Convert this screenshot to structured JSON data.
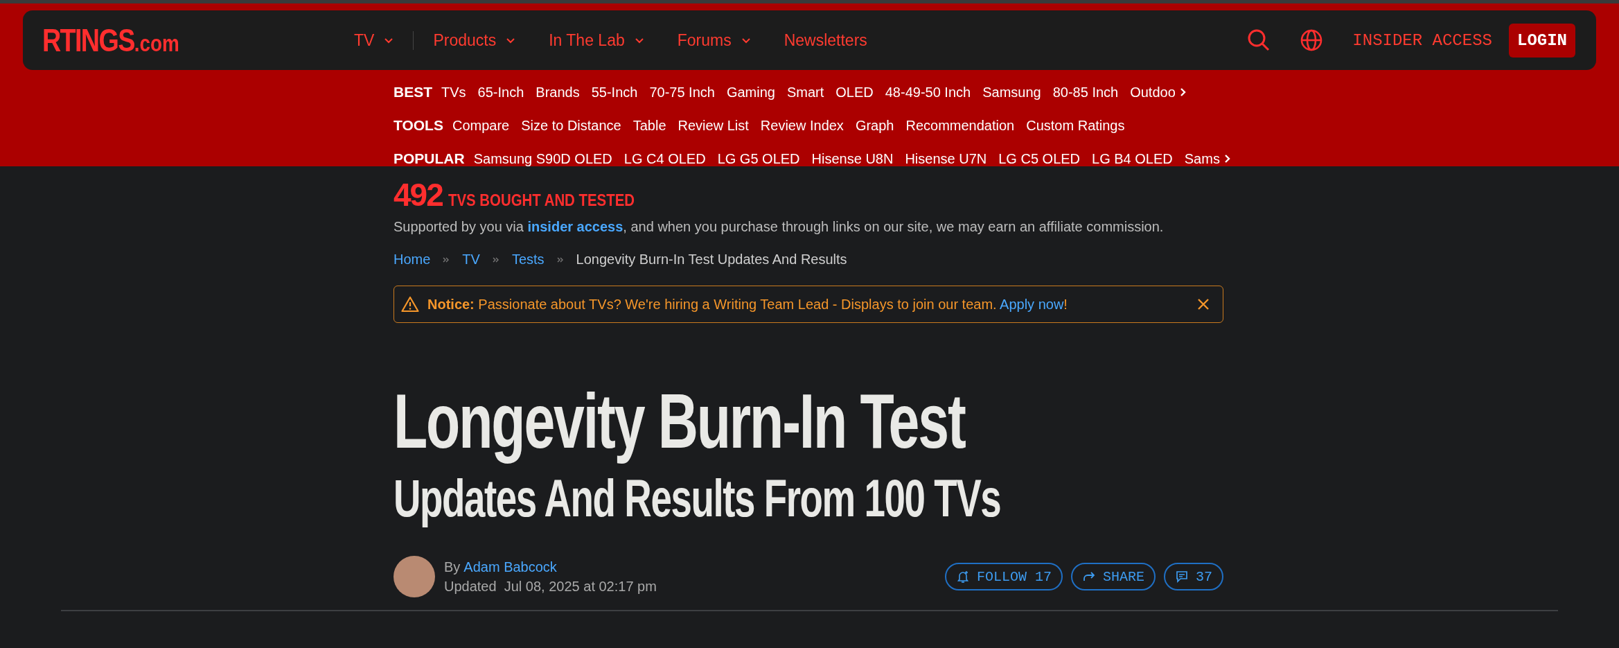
{
  "header": {
    "logo": {
      "main": "RTINGS",
      "suffix": ".com"
    },
    "nav": [
      {
        "label": "TV",
        "has_menu": true,
        "divider_after": true
      },
      {
        "label": "Products",
        "has_menu": true,
        "divider_after": false
      },
      {
        "label": "In The Lab",
        "has_menu": true,
        "divider_after": false
      },
      {
        "label": "Forums",
        "has_menu": true,
        "divider_after": false
      },
      {
        "label": "Newsletters",
        "has_menu": false,
        "divider_after": false
      }
    ],
    "insider_access": "INSIDER ACCESS",
    "login": "LOGIN"
  },
  "subnav": [
    {
      "label": "BEST",
      "items": [
        "TVs",
        "65-Inch",
        "Brands",
        "55-Inch",
        "70-75 Inch",
        "Gaming",
        "Smart",
        "OLED",
        "48-49-50 Inch",
        "Samsung",
        "80-85 Inch",
        "Outdoo"
      ],
      "more": true
    },
    {
      "label": "TOOLS",
      "items": [
        "Compare",
        "Size to Distance",
        "Table",
        "Review List",
        "Review Index",
        "Graph",
        "Recommendation",
        "Custom Ratings"
      ],
      "more": false
    },
    {
      "label": "POPULAR",
      "items": [
        "Samsung S90D OLED",
        "LG C4 OLED",
        "LG G5 OLED",
        "Hisense U8N",
        "Hisense U7N",
        "LG C5 OLED",
        "LG B4 OLED",
        "Sams"
      ],
      "more": true
    }
  ],
  "tested": {
    "count": "492",
    "label": "TVS BOUGHT AND TESTED"
  },
  "support": {
    "before": "Supported by you via ",
    "link": "insider access",
    "after": ", and when you purchase through links on our site, we may earn an affiliate commission."
  },
  "breadcrumbs": [
    {
      "label": "Home",
      "link": true
    },
    {
      "label": "TV",
      "link": true
    },
    {
      "label": "Tests",
      "link": true
    },
    {
      "label": "Longevity Burn-In Test Updates And Results",
      "link": false
    }
  ],
  "notice": {
    "label": "Notice:",
    "text": " Passionate about TVs? We're hiring a Writing Team Lead - Displays to join our team. ",
    "link": "Apply now",
    "end": "!"
  },
  "title": {
    "line1": "Longevity Burn-In Test",
    "line2": "Updates And Results From 100 TVs"
  },
  "byline": {
    "by": "By",
    "author": "Adam Babcock",
    "updated": "Updated  Jul 08, 2025 at 02:17 pm"
  },
  "actions": [
    {
      "kind": "follow",
      "label": "FOLLOW 17"
    },
    {
      "kind": "share",
      "label": "SHARE"
    },
    {
      "kind": "comments",
      "label": "37"
    }
  ]
}
